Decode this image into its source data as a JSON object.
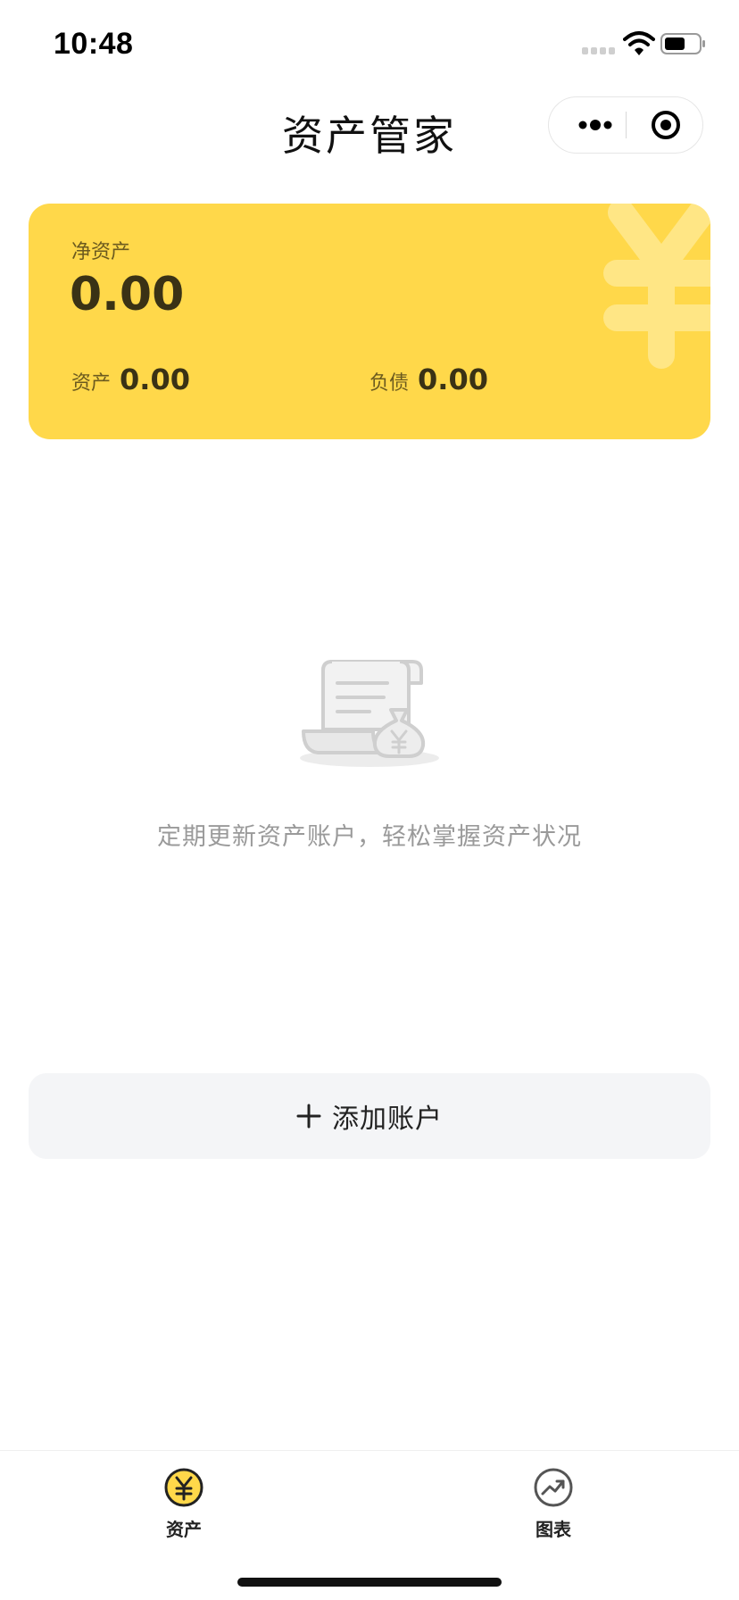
{
  "status_bar": {
    "time": "10:48"
  },
  "nav": {
    "title": "资产管家"
  },
  "summary": {
    "net_label": "净资产",
    "net_value": "0.00",
    "assets_label": "资产",
    "assets_value": "0.00",
    "liabilities_label": "负债",
    "liabilities_value": "0.00"
  },
  "empty_state": {
    "message": "定期更新资产账户，轻松掌握资产状况"
  },
  "actions": {
    "add_account_label": "添加账户"
  },
  "tab_bar": {
    "items": [
      {
        "label": "资产",
        "icon": "yen-icon",
        "active": true
      },
      {
        "label": "图表",
        "icon": "trend-chart-icon",
        "active": false
      }
    ]
  },
  "colors": {
    "card_bg": "#ffd84a",
    "accent": "#ffd84a",
    "empty_text": "#9a9a9a",
    "button_bg": "#f4f5f7"
  }
}
